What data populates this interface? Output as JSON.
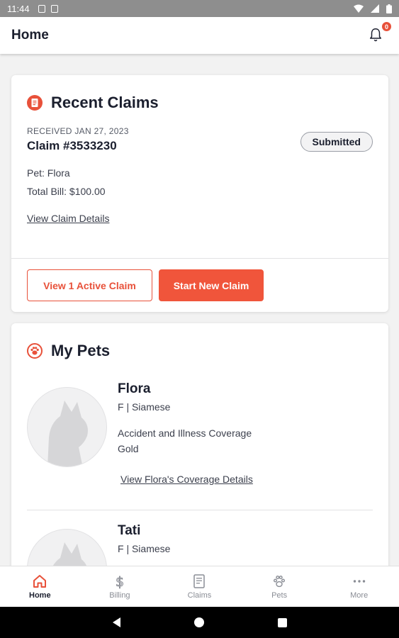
{
  "status_bar": {
    "time": "11:44"
  },
  "app_bar": {
    "title": "Home",
    "notification_count": "0"
  },
  "recent_claims": {
    "title": "Recent Claims",
    "received_label": "RECEIVED JAN 27, 2023",
    "claim_number": "Claim #3533230",
    "status": "Submitted",
    "pet_line": "Pet: Flora",
    "total_bill_line": "Total Bill: $100.00",
    "details_link": "View Claim Details",
    "active_button": "View 1 Active Claim",
    "new_claim_button": "Start New Claim"
  },
  "my_pets": {
    "title": "My Pets",
    "pets": [
      {
        "name": "Flora",
        "meta": "F | Siamese",
        "coverage": "Accident and Illness Coverage",
        "plan": "Gold",
        "link": "View Flora's Coverage Details"
      },
      {
        "name": "Tati",
        "meta": "F | Siamese"
      }
    ]
  },
  "bottom_nav": {
    "items": [
      {
        "label": "Home",
        "icon": "home-icon",
        "active": true
      },
      {
        "label": "Billing",
        "icon": "dollar-icon",
        "active": false
      },
      {
        "label": "Claims",
        "icon": "document-icon",
        "active": false
      },
      {
        "label": "Pets",
        "icon": "paw-icon",
        "active": false
      },
      {
        "label": "More",
        "icon": "more-dots-icon",
        "active": false
      }
    ]
  },
  "colors": {
    "accent": "#e8513a",
    "text": "#1b1f2e",
    "background": "#f2f2f2"
  }
}
